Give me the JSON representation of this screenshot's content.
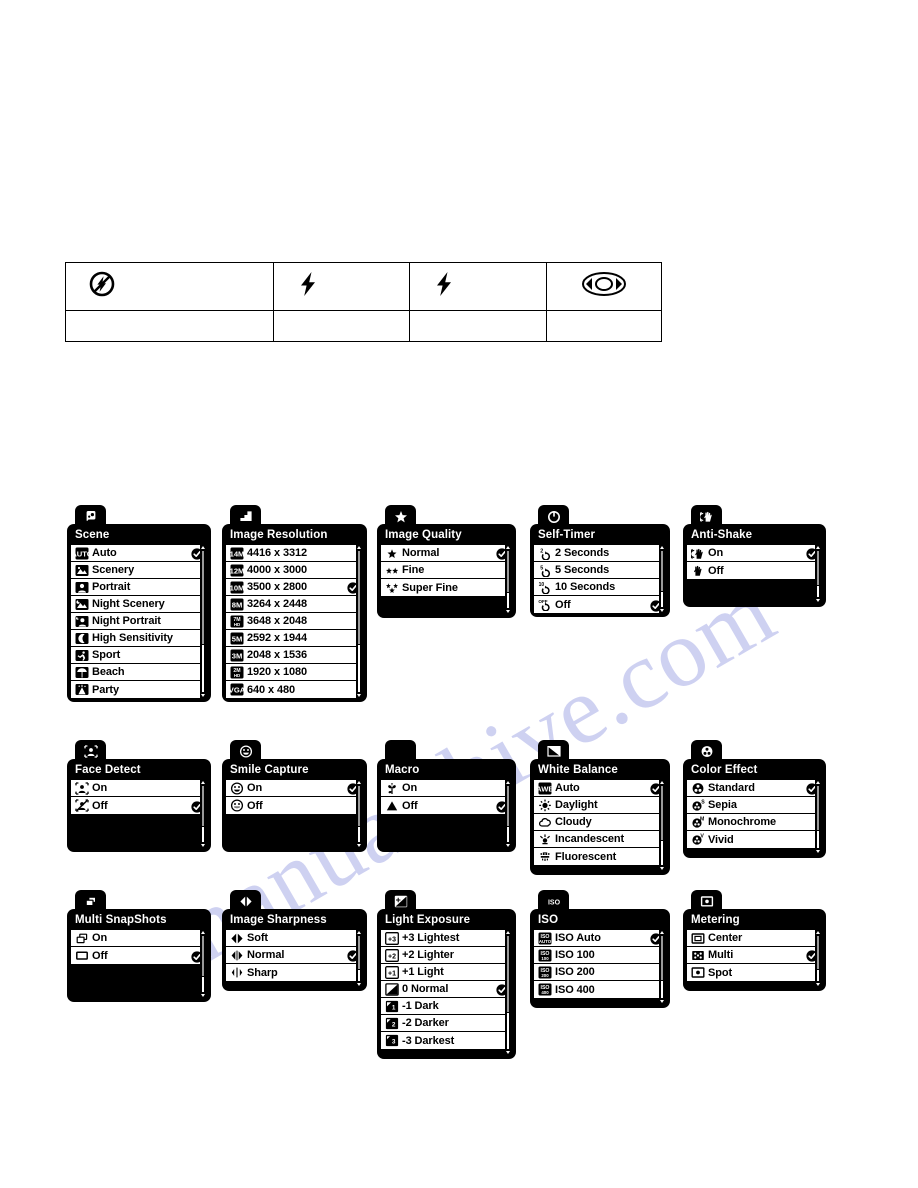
{
  "watermark": {
    "text": "manualshive.com"
  },
  "flash_table": {
    "row1": [
      {
        "icon": "flash-off-icon",
        "label": ""
      },
      {
        "icon": "flash-bolt-icon",
        "label": ""
      },
      {
        "icon": "flash-bolt-icon",
        "label": ""
      },
      {
        "icon": "red-eye-icon",
        "label": ""
      }
    ],
    "row2": [
      {
        "label": ""
      },
      {
        "label": ""
      },
      {
        "label": ""
      },
      {
        "label": ""
      }
    ]
  },
  "panels": [
    {
      "id": "scene",
      "tab_icon": "scene-icon",
      "title": "Scene",
      "rows": [
        {
          "icon": "auto-badge-icon",
          "label": "Auto",
          "checked": true
        },
        {
          "icon": "scenery-icon",
          "label": "Scenery",
          "checked": false
        },
        {
          "icon": "portrait-icon",
          "label": "Portrait",
          "checked": false
        },
        {
          "icon": "night-scenery-icon",
          "label": "Night Scenery",
          "checked": false
        },
        {
          "icon": "night-portrait-icon",
          "label": "Night Portrait",
          "checked": false
        },
        {
          "icon": "high-sensitivity-icon",
          "label": "High Sensitivity",
          "checked": false
        },
        {
          "icon": "sport-icon",
          "label": "Sport",
          "checked": false
        },
        {
          "icon": "beach-icon",
          "label": "Beach",
          "checked": false
        },
        {
          "icon": "party-icon",
          "label": "Party",
          "checked": false
        }
      ]
    },
    {
      "id": "image-resolution",
      "tab_icon": "resolution-icon",
      "title": "Image Resolution",
      "rows": [
        {
          "icon": "14m-badge-icon",
          "label": "4416 x 3312",
          "checked": false
        },
        {
          "icon": "12m-badge-icon",
          "label": "4000 x 3000",
          "checked": false
        },
        {
          "icon": "10m-badge-icon",
          "label": "3500 x 2800",
          "checked": true
        },
        {
          "icon": "8m-badge-icon",
          "label": "3264 x 2448",
          "checked": false
        },
        {
          "icon": "7mhd-badge-icon",
          "label": "3648 x 2048",
          "checked": false
        },
        {
          "icon": "5m-badge-icon",
          "label": "2592 x 1944",
          "checked": false
        },
        {
          "icon": "3m-badge-icon",
          "label": "2048 x 1536",
          "checked": false
        },
        {
          "icon": "2mhd-badge-icon",
          "label": "1920 x 1080",
          "checked": false
        },
        {
          "icon": "vga-badge-icon",
          "label": "640 x 480",
          "checked": false
        }
      ]
    },
    {
      "id": "image-quality",
      "tab_icon": "star-icon",
      "title": "Image Quality",
      "rows": [
        {
          "icon": "one-star-icon",
          "label": "Normal",
          "checked": true
        },
        {
          "icon": "two-stars-icon",
          "label": "Fine",
          "checked": false
        },
        {
          "icon": "three-stars-icon",
          "label": "Super Fine",
          "checked": false
        }
      ]
    },
    {
      "id": "self-timer",
      "tab_icon": "timer-icon",
      "title": "Self-Timer",
      "rows": [
        {
          "icon": "timer-2s-icon",
          "label": "2 Seconds",
          "checked": false
        },
        {
          "icon": "timer-5s-icon",
          "label": "5 Seconds",
          "checked": false
        },
        {
          "icon": "timer-10s-icon",
          "label": "10 Seconds",
          "checked": false
        },
        {
          "icon": "timer-off-icon",
          "label": "Off",
          "checked": true
        }
      ]
    },
    {
      "id": "anti-shake",
      "tab_icon": "hand-shake-icon",
      "title": "Anti-Shake",
      "rows": [
        {
          "icon": "hand-shake-on-icon",
          "label": "On",
          "checked": true
        },
        {
          "icon": "hand-shake-off-icon",
          "label": "Off",
          "checked": false
        }
      ]
    },
    {
      "id": "face-detect",
      "tab_icon": "face-detect-icon",
      "title": "Face Detect",
      "rows": [
        {
          "icon": "face-on-icon",
          "label": "On",
          "checked": false
        },
        {
          "icon": "face-off-icon",
          "label": "Off",
          "checked": true
        }
      ]
    },
    {
      "id": "smile-capture",
      "tab_icon": "smile-icon",
      "title": "Smile Capture",
      "rows": [
        {
          "icon": "smile-on-icon",
          "label": "On",
          "checked": true
        },
        {
          "icon": "smile-off-icon",
          "label": "Off",
          "checked": false
        }
      ]
    },
    {
      "id": "macro",
      "tab_icon": "macro-flower-icon",
      "title": "Macro",
      "rows": [
        {
          "icon": "macro-flower-icon",
          "label": "On",
          "checked": false
        },
        {
          "icon": "mountain-far-icon",
          "label": "Off",
          "checked": true
        }
      ]
    },
    {
      "id": "white-balance",
      "tab_icon": "white-balance-icon",
      "title": "White Balance",
      "rows": [
        {
          "icon": "awb-badge-icon",
          "label": "Auto",
          "checked": true
        },
        {
          "icon": "daylight-icon",
          "label": "Daylight",
          "checked": false
        },
        {
          "icon": "cloudy-icon",
          "label": "Cloudy",
          "checked": false
        },
        {
          "icon": "incandescent-icon",
          "label": "Incandescent",
          "checked": false
        },
        {
          "icon": "fluorescent-icon",
          "label": "Fluorescent",
          "checked": false
        }
      ]
    },
    {
      "id": "color-effect",
      "tab_icon": "color-effect-icon",
      "title": "Color Effect",
      "rows": [
        {
          "icon": "color-standard-icon",
          "label": "Standard",
          "checked": true
        },
        {
          "icon": "color-sepia-icon",
          "label": "Sepia",
          "checked": false
        },
        {
          "icon": "color-monochrome-icon",
          "label": "Monochrome",
          "checked": false
        },
        {
          "icon": "color-vivid-icon",
          "label": "Vivid",
          "checked": false
        }
      ]
    },
    {
      "id": "multi-snapshots",
      "tab_icon": "multi-frames-icon",
      "title": "Multi SnapShots",
      "rows": [
        {
          "icon": "multi-frames-icon",
          "label": "On",
          "checked": false
        },
        {
          "icon": "single-frame-icon",
          "label": "Off",
          "checked": true
        }
      ]
    },
    {
      "id": "image-sharpness",
      "tab_icon": "sharpness-icon",
      "title": "Image Sharpness",
      "rows": [
        {
          "icon": "sharp-soft-icon",
          "label": "Soft",
          "checked": false
        },
        {
          "icon": "sharp-normal-icon",
          "label": "Normal",
          "checked": true
        },
        {
          "icon": "sharp-sharp-icon",
          "label": "Sharp",
          "checked": false
        }
      ]
    },
    {
      "id": "light-exposure",
      "tab_icon": "exposure-icon",
      "title": "Light Exposure",
      "rows": [
        {
          "icon": "ev-plus3-icon",
          "label": "+3 Lightest",
          "checked": false
        },
        {
          "icon": "ev-plus2-icon",
          "label": "+2 Lighter",
          "checked": false
        },
        {
          "icon": "ev-plus1-icon",
          "label": "+1 Light",
          "checked": false
        },
        {
          "icon": "ev-zero-icon",
          "label": "0 Normal",
          "checked": true
        },
        {
          "icon": "ev-minus1-icon",
          "label": "-1 Dark",
          "checked": false
        },
        {
          "icon": "ev-minus2-icon",
          "label": "-2 Darker",
          "checked": false
        },
        {
          "icon": "ev-minus3-icon",
          "label": "-3 Darkest",
          "checked": false
        }
      ]
    },
    {
      "id": "iso",
      "tab_icon": "iso-icon",
      "title": "ISO",
      "rows": [
        {
          "icon": "iso-auto-icon",
          "label": "ISO Auto",
          "checked": true
        },
        {
          "icon": "iso-100-icon",
          "label": "ISO 100",
          "checked": false
        },
        {
          "icon": "iso-200-icon",
          "label": "ISO 200",
          "checked": false
        },
        {
          "icon": "iso-400-icon",
          "label": "ISO 400",
          "checked": false
        }
      ]
    },
    {
      "id": "metering",
      "tab_icon": "metering-icon",
      "title": "Metering",
      "rows": [
        {
          "icon": "metering-center-icon",
          "label": "Center",
          "checked": false
        },
        {
          "icon": "metering-multi-icon",
          "label": "Multi",
          "checked": true
        },
        {
          "icon": "metering-spot-icon",
          "label": "Spot",
          "checked": false
        }
      ]
    }
  ],
  "colors": {
    "panel_bg": "#000000",
    "row_bg": "#ffffff",
    "text_on_dark": "#ffffff",
    "watermark": "#c6c9ef"
  }
}
